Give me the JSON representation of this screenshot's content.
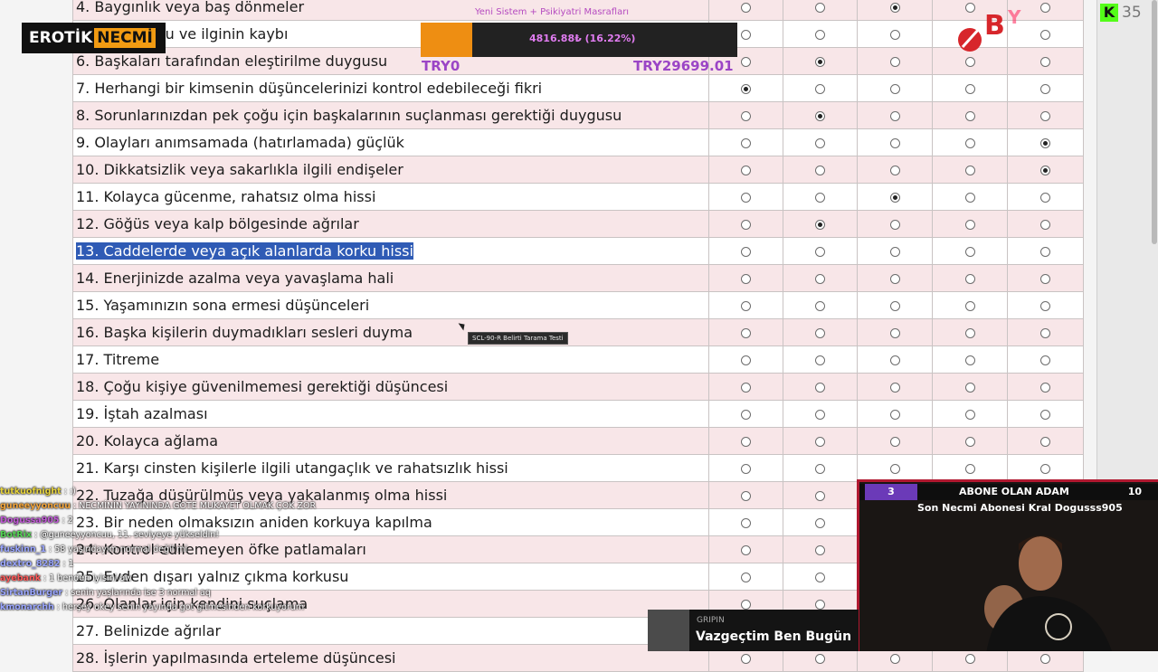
{
  "questions": [
    {
      "text": "4. Baygınlık veya baş dönmeler",
      "answer": 2
    },
    {
      "text": "5. Cinsel arzu ve ilginin kaybı",
      "answer": -1
    },
    {
      "text": "6. Başkaları tarafından eleştirilme duygusu",
      "answer": 1
    },
    {
      "text": "7. Herhangi bir kimsenin düşüncelerinizi kontrol edebileceği fikri",
      "answer": 0
    },
    {
      "text": "8. Sorunlarınızdan pek çoğu için başkalarının suçlanması gerektiği duygusu",
      "answer": 1
    },
    {
      "text": "9. Olayları anımsamada (hatırlamada) güçlük",
      "answer": 4
    },
    {
      "text": "10. Dikkatsizlik veya sakarlıkla ilgili endişeler",
      "answer": 4
    },
    {
      "text": "11. Kolayca gücenme, rahatsız olma hissi",
      "answer": 2
    },
    {
      "text": "12. Göğüs veya kalp bölgesinde ağrılar",
      "answer": 1
    },
    {
      "text": "13. Caddelerde veya açık alanlarda korku hissi",
      "answer": -1,
      "selected": true
    },
    {
      "text": "14. Enerjinizde azalma veya yavaşlama hali",
      "answer": -1
    },
    {
      "text": "15. Yaşamınızın sona ermesi düşünceleri",
      "answer": -1
    },
    {
      "text": "16. Başka kişilerin duymadıkları sesleri duyma",
      "answer": -1
    },
    {
      "text": "17. Titreme",
      "answer": -1
    },
    {
      "text": "18. Çoğu kişiye güvenilmemesi gerektiği düşüncesi",
      "answer": -1
    },
    {
      "text": "19. İştah azalması",
      "answer": -1
    },
    {
      "text": "20. Kolayca ağlama",
      "answer": -1
    },
    {
      "text": "21. Karşı cinsten kişilerle ilgili utangaçlık ve rahatsızlık hissi",
      "answer": -1
    },
    {
      "text": "22. Tuzağa düşürülmüş veya yakalanmış olma hissi",
      "answer": -1
    },
    {
      "text": "23. Bir neden olmaksızın aniden korkuya kapılma",
      "answer": -1
    },
    {
      "text": "24. Kontrol edilemeyen öfke patlamaları",
      "answer": -1
    },
    {
      "text": "25. Evden dışarı yalnız çıkma korkusu",
      "answer": -1
    },
    {
      "text": "26. Olanlar için kendini suçlama",
      "answer": -1
    },
    {
      "text": "27. Belinizde ağrılar",
      "answer": -1
    },
    {
      "text": "28. İşlerin yapılmasında erteleme düşüncesi",
      "answer": -1
    }
  ],
  "option_count": 5,
  "tooltip": "SCL-90-R Belirti Tarama Testi",
  "logo": {
    "left": "EROTİK",
    "badge": "NECMİ"
  },
  "goal": {
    "title": "Yeni Sistem + Psikiyatri Masrafları",
    "amount": "4816.88₺ (16.22%)",
    "progress": 0.1622,
    "min_label": "TRY0",
    "max_label": "TRY29699.01"
  },
  "kick": {
    "icon": "K",
    "count": "35"
  },
  "chat": [
    {
      "user": "tutkuofnight",
      "text": ": :)",
      "color": "#e7d33a"
    },
    {
      "user": "guneeyyoncuu",
      "text": ": NECMİNİN YAYININDA GOTE MUKAYET OLMAK ÇOK ZOR",
      "color": "#f2a43a"
    },
    {
      "user": "Dogussa905",
      "text": ": 2",
      "color": "#c25ad8"
    },
    {
      "user": "BotRix",
      "text": ": @guneeyyoncuu, 11. seviyeye yükseldin!",
      "color": "#55d455"
    },
    {
      "user": "fuskinn_1",
      "text": ": 58 yaşındayım normal değil mi",
      "color": "#9aa6ff"
    },
    {
      "user": "dextro_8282",
      "text": ": 1",
      "color": "#9aa6ff"
    },
    {
      "user": "ayebank",
      "text": ": 1 benden iyisini aw",
      "color": "#ff5a5a"
    },
    {
      "user": "SirtanBurger",
      "text": ": senin yaşlarında ise 3 normal aq",
      "color": "#9aa6ff"
    },
    {
      "user": "kmonarchh",
      "text": ": herşey okey senin yayında got gitmesinden korkuyorum",
      "color": "#9aa6ff"
    }
  ],
  "cam": {
    "left_count": "3",
    "title": "ABONE OLAN ADAM",
    "right_count": "10",
    "subtitle": "Son Necmi Abonesi Kral Dogusss905"
  },
  "music": {
    "artist": "GRIPIN",
    "song": "Vazgeçtim Ben Bugün"
  },
  "colors": {
    "row_odd": "#f8e6e8",
    "row_even": "#ffffff",
    "selection": "#2f5bb5",
    "goal_fill": "#ee8e12"
  }
}
